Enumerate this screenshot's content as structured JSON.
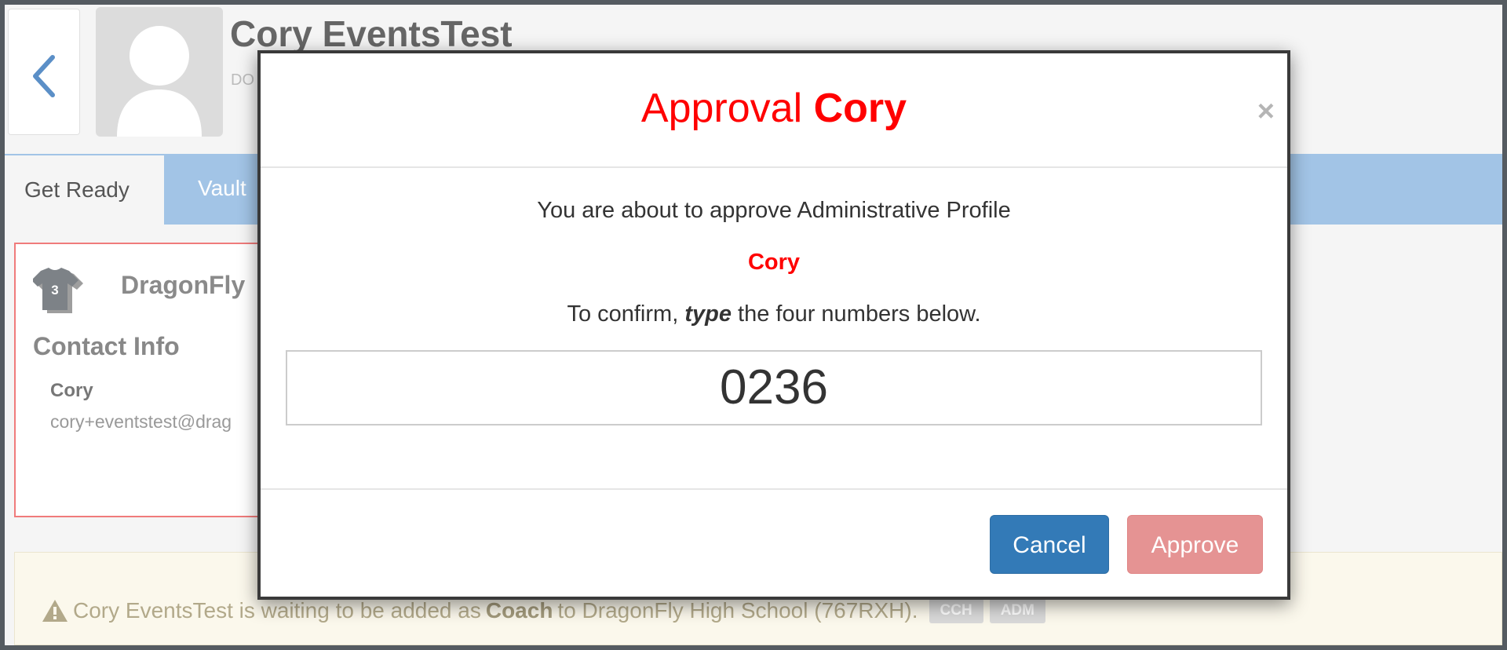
{
  "header": {
    "name": "Cory EventsTest",
    "sub_code": "DO"
  },
  "tabs": {
    "active": "Get Ready",
    "second": "Vault"
  },
  "card": {
    "jersey_number": "3",
    "school": "DragonFly",
    "contact_heading": "Contact Info",
    "contact_name": "Cory",
    "contact_email": "cory+eventstest@drag"
  },
  "notice": {
    "before": "Cory EventsTest is waiting to be added as",
    "role": "Coach",
    "after": "to DragonFly High School (767RXH).",
    "chips": [
      "CCH",
      "ADM"
    ]
  },
  "modal": {
    "title_prefix": "Approval",
    "title_name": "Cory",
    "close_label": "×",
    "message": "You are about to approve Administrative Profile",
    "profile_name": "Cory",
    "confirm_prefix": "To confirm,",
    "confirm_emphasis": "type",
    "confirm_suffix": "the four numbers below.",
    "code": "0236",
    "cancel_label": "Cancel",
    "approve_label": "Approve"
  },
  "colors": {
    "accent_red": "#ff0000",
    "primary_blue": "#337ab7",
    "approve_disabled": "#e59393",
    "tab_bar": "#a2c4e6"
  },
  "icons": [
    "back-chevron-icon",
    "avatar-placeholder-icon",
    "jersey-icon",
    "warning-icon",
    "close-icon"
  ]
}
